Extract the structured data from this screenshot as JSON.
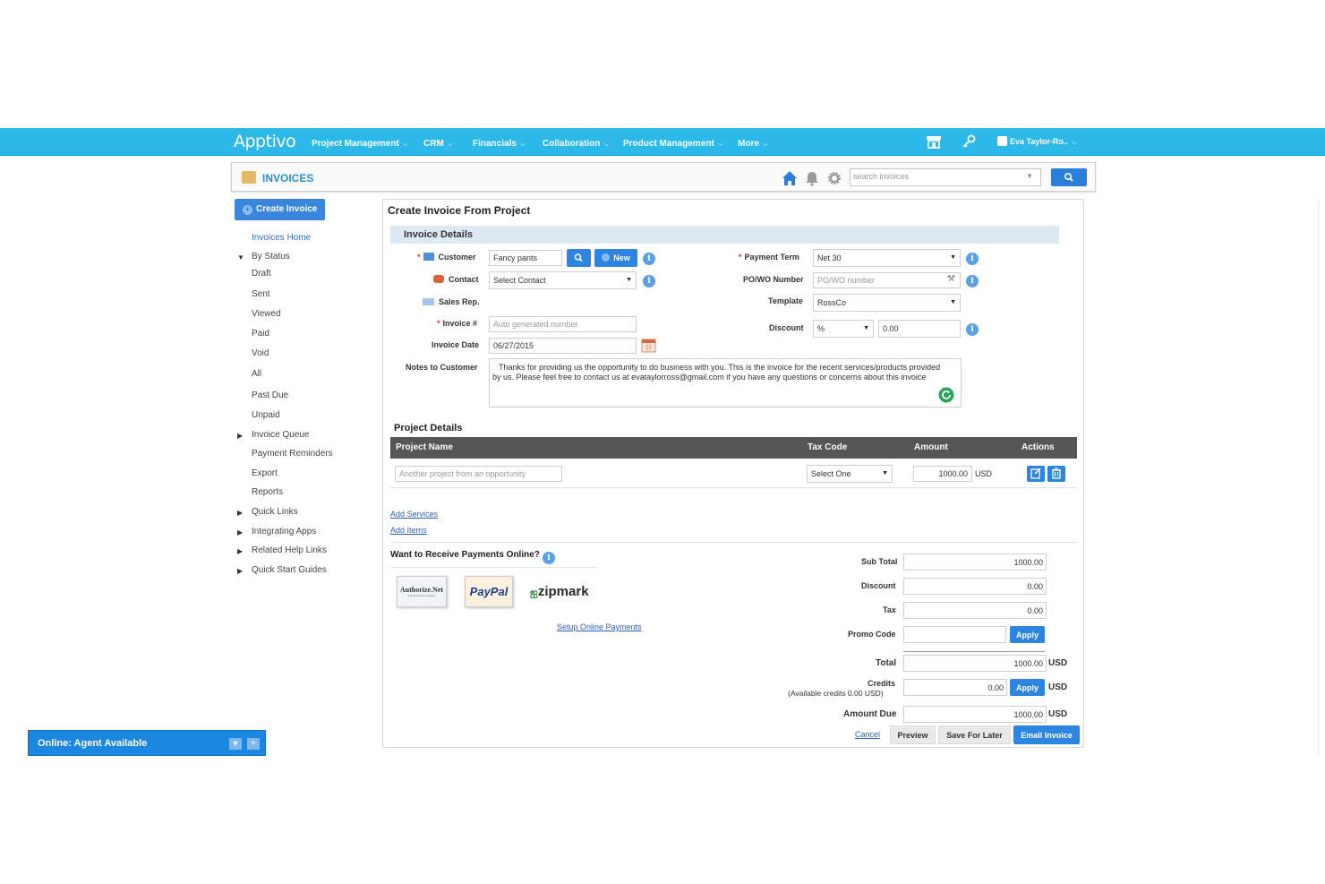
{
  "topnav": {
    "logo": "Apptivo",
    "items": [
      "Project Management",
      "CRM",
      "Financials",
      "Collaboration",
      "Product Management",
      "More"
    ],
    "user": "Eva Taylor-Ro.."
  },
  "app": {
    "title": "INVOICES",
    "search_placeholder": "search invoices"
  },
  "sidebar": {
    "create_button": "Create Invoice",
    "invoices_home": "Invoices Home",
    "by_status": "By Status",
    "statuses": [
      "Draft",
      "Sent",
      "Viewed",
      "Paid",
      "Void",
      "All"
    ],
    "past_due": "Past Due",
    "unpaid": "Unpaid",
    "invoice_queue": "Invoice Queue",
    "payment_reminders": "Payment Reminders",
    "export": "Export",
    "reports": "Reports",
    "quick_links": "Quick Links",
    "integrating_apps": "Integrating Apps",
    "related_help_links": "Related Help Links",
    "quick_start_guides": "Quick Start Guides"
  },
  "form": {
    "title": "Create Invoice From Project",
    "section": "Invoice Details",
    "customer_label": "Customer",
    "customer_value": "Fancy pants",
    "new_button": "New",
    "contact_label": "Contact",
    "contact_value": "Select Contact",
    "sales_rep_label": "Sales Rep.",
    "invoice_no_label": "Invoice #",
    "invoice_no_placeholder": "Auto generated number",
    "invoice_date_label": "Invoice Date",
    "invoice_date_value": "06/27/2015",
    "notes_label": "Notes to Customer",
    "notes_line1": "Thanks for providing us the opportunity to do business with you. This is the invoice for the recent services/products provided",
    "notes_line2": "by us. Please feel free to contact us at evataylorross@gmail.com if you have any questions or concerns about this invoice",
    "payment_term_label": "Payment Term",
    "payment_term_value": "Net 30",
    "po_label": "PO/WO Number",
    "po_placeholder": "PO/WO number",
    "template_label": "Template",
    "template_value": "RossCo",
    "discount_label": "Discount",
    "discount_type": "%",
    "discount_value": "0.00"
  },
  "project": {
    "title": "Project Details",
    "headers": [
      "Project Name",
      "Tax Code",
      "Amount",
      "Actions"
    ],
    "row": {
      "name": "Another project from an opportunity",
      "tax_code": "Select One",
      "amount": "1000.00",
      "currency": "USD"
    },
    "add_services": "Add Services",
    "add_items": "Add Items"
  },
  "payments": {
    "title": "Want to Receive Payments Online?",
    "authorize": "Authorize.Net",
    "authorize_sub": "a CyberSource solution",
    "paypal": "PayPal",
    "zipmark": "zipmark",
    "setup_link": "Setup Online Payments"
  },
  "totals": {
    "sub_total_label": "Sub Total",
    "sub_total": "1000.00",
    "discount_label": "Discount",
    "discount": "0.00",
    "tax_label": "Tax",
    "tax": "0.00",
    "promo_label": "Promo Code",
    "apply": "Apply",
    "total_label": "Total",
    "total": "1000.00",
    "credits_label": "Credits",
    "credits_sub": "(Available credits 0.00 USD)",
    "credits": "0.00",
    "amount_due_label": "Amount Due",
    "amount_due": "1000.00",
    "currency": "USD"
  },
  "actions": {
    "cancel": "Cancel",
    "preview": "Preview",
    "save_later": "Save For Later",
    "email": "Email Invoice"
  },
  "chat": {
    "status": "Online: Agent Available"
  }
}
